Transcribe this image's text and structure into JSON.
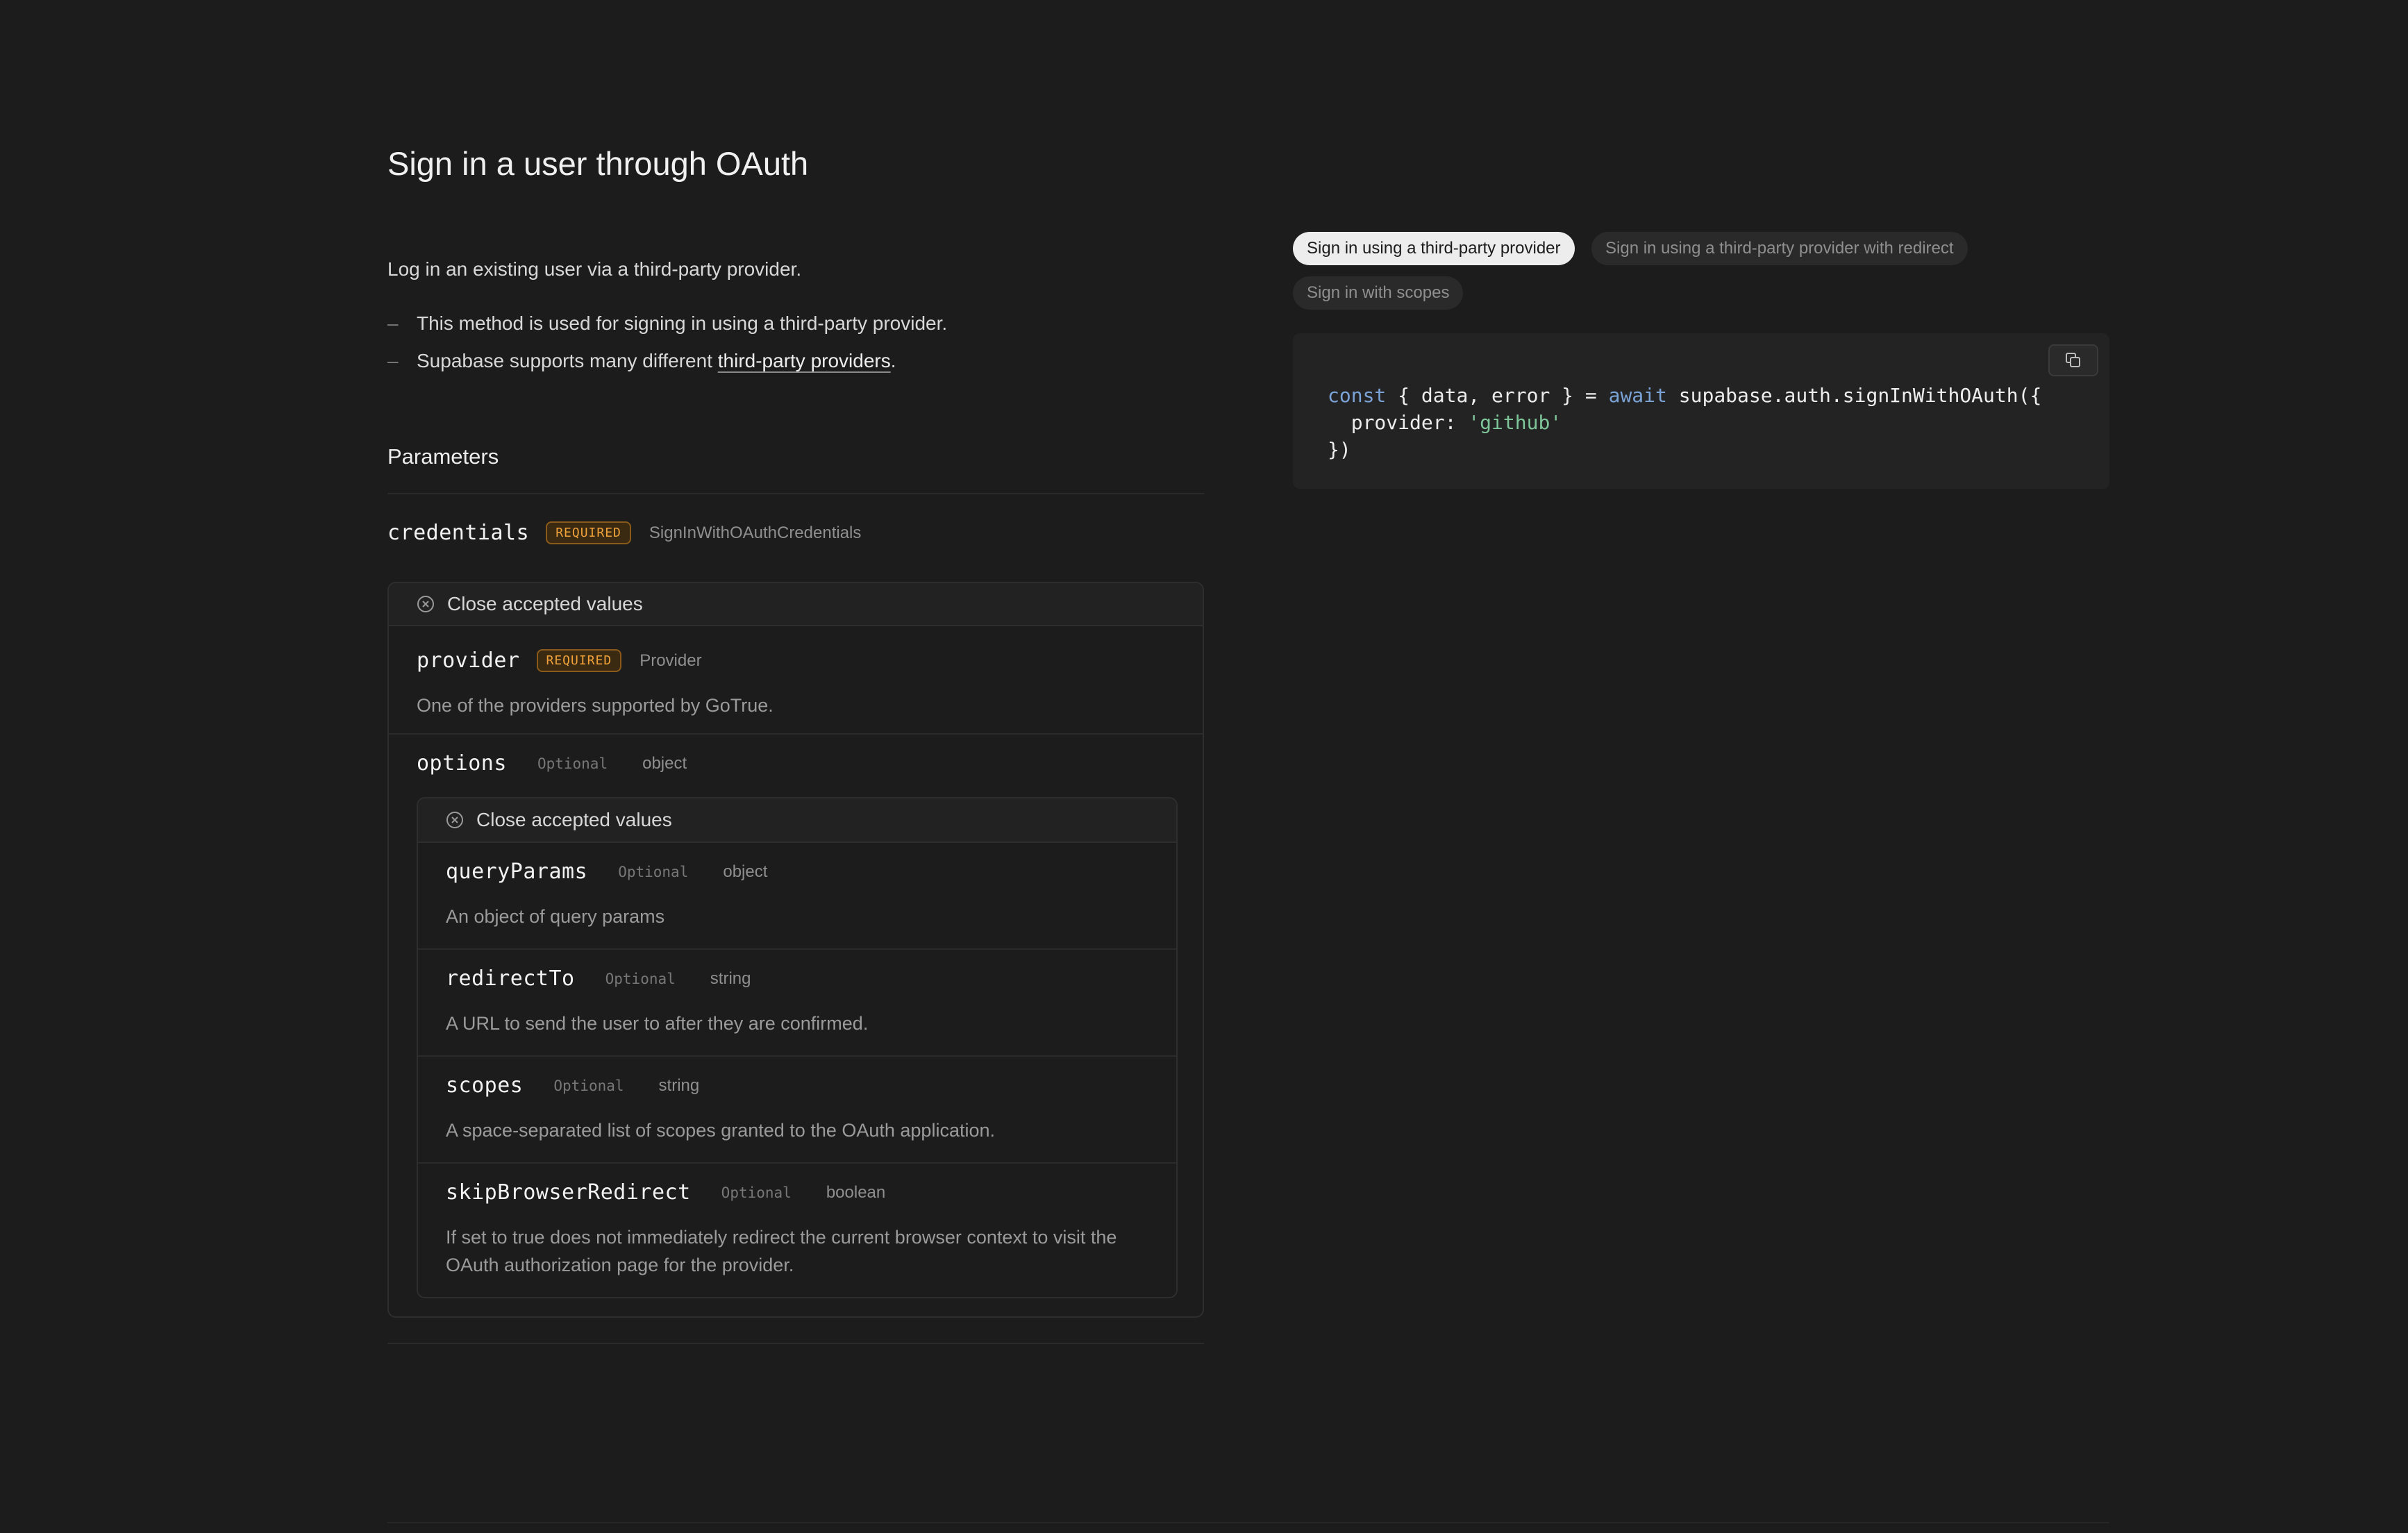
{
  "title": "Sign in a user through OAuth",
  "intro": "Log in an existing user via a third-party provider.",
  "bullets": {
    "dash": "–",
    "first": "This method is used for signing in using a third-party provider.",
    "second_prefix": "Supabase supports many different ",
    "second_link": "third-party providers",
    "second_suffix": "."
  },
  "parameters": {
    "title": "Parameters",
    "credentials": {
      "name": "credentials",
      "badge": "REQUIRED",
      "type": "SignInWithOAuthCredentials",
      "close_label": "Close accepted values",
      "provider": {
        "name": "provider",
        "badge": "REQUIRED",
        "type": "Provider",
        "description": "One of the providers supported by GoTrue."
      },
      "options": {
        "name": "options",
        "badge": "Optional",
        "type": "object",
        "close_label": "Close accepted values",
        "items": [
          {
            "name": "queryParams",
            "badge": "Optional",
            "type": "object",
            "description": "An object of query params"
          },
          {
            "name": "redirectTo",
            "badge": "Optional",
            "type": "string",
            "description": "A URL to send the user to after they are confirmed."
          },
          {
            "name": "scopes",
            "badge": "Optional",
            "type": "string",
            "description": "A space-separated list of scopes granted to the OAuth application."
          },
          {
            "name": "skipBrowserRedirect",
            "badge": "Optional",
            "type": "boolean",
            "description": "If set to true does not immediately redirect the current browser context to visit the OAuth authorization page for the provider."
          }
        ]
      }
    }
  },
  "example_tabs": [
    {
      "label": "Sign in using a third-party provider",
      "active": true
    },
    {
      "label": "Sign in using a third-party provider with redirect",
      "active": false
    },
    {
      "label": "Sign in with scopes",
      "active": false
    }
  ],
  "code": {
    "kw_const": "const",
    "part1": " { data, error } = ",
    "kw_await": "await",
    "part2": " supabase.auth.signInWithOAuth({",
    "line2_prefix": "  provider: ",
    "line2_string": "'github'",
    "line3": "})",
    "copy_icon": "copy-icon"
  },
  "colors": {
    "background": "#1c1c1c",
    "required_badge": "#f1a33a",
    "keyword": "#7ba3d6",
    "string": "#7ec699"
  }
}
